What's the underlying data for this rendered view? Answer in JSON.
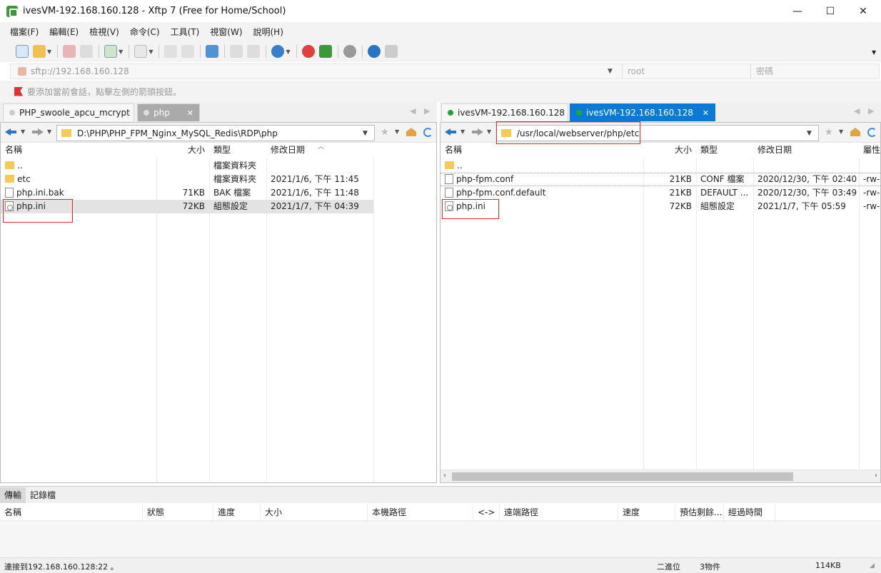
{
  "window": {
    "title": "ivesVM-192.168.160.128 - Xftp 7 (Free for Home/School)",
    "min": "—",
    "max": "☐",
    "close": "✕"
  },
  "menu": [
    "檔案(F)",
    "編輯(E)",
    "檢視(V)",
    "命令(C)",
    "工具(T)",
    "視窗(W)",
    "說明(H)"
  ],
  "address": {
    "host": "sftp://192.168.160.128",
    "user_placeholder": "root",
    "password_placeholder": "密碼"
  },
  "hint": "要添加當前會話，點擊左側的箭頭按鈕。",
  "local": {
    "tabs": [
      {
        "label": "PHP_swoole_apcu_mcrypt"
      },
      {
        "label": "php",
        "close": "✕"
      }
    ],
    "path": "D:\\PHP\\PHP_FPM_Nginx_MySQL_Redis\\RDP\\php",
    "columns": [
      "名稱",
      "大小",
      "類型",
      "修改日期"
    ],
    "files": [
      {
        "name": "..",
        "size": "",
        "type": "檔案資料夾",
        "date": "",
        "icon": "folder"
      },
      {
        "name": "etc",
        "size": "",
        "type": "檔案資料夾",
        "date": "2021/1/6, 下午 11:45",
        "icon": "folder"
      },
      {
        "name": "php.ini.bak",
        "size": "71KB",
        "type": "BAK 檔案",
        "date": "2021/1/6, 下午 11:48",
        "icon": "doc"
      },
      {
        "name": "php.ini",
        "size": "72KB",
        "type": "組態設定",
        "date": "2021/1/7, 下午 04:39",
        "icon": "ini"
      }
    ]
  },
  "remote": {
    "tabs": [
      {
        "label": "ivesVM-192.168.160.128"
      },
      {
        "label": "ivesVM-192.168.160.128",
        "close": "✕"
      }
    ],
    "path": "/usr/local/webserver/php/etc",
    "columns": [
      "名稱",
      "大小",
      "類型",
      "修改日期",
      "屬性"
    ],
    "files": [
      {
        "name": "..",
        "size": "",
        "type": "",
        "date": "",
        "attr": "",
        "icon": "folder"
      },
      {
        "name": "php-fpm.conf",
        "size": "21KB",
        "type": "CONF 檔案",
        "date": "2020/12/30, 下午 02:40",
        "attr": "-rw-",
        "icon": "doc"
      },
      {
        "name": "php-fpm.conf.default",
        "size": "21KB",
        "type": "DEFAULT ...",
        "date": "2020/12/30, 下午 03:49",
        "attr": "-rw-",
        "icon": "doc"
      },
      {
        "name": "php.ini",
        "size": "72KB",
        "type": "組態設定",
        "date": "2021/1/7, 下午 05:59",
        "attr": "-rw-",
        "icon": "ini"
      }
    ]
  },
  "bottom": {
    "tabs": [
      "傳輸",
      "記錄檔"
    ],
    "columns": [
      "名稱",
      "狀態",
      "進度",
      "大小",
      "本機路徑",
      "<->",
      "遠端路徑",
      "速度",
      "預估剩餘...",
      "經過時間"
    ]
  },
  "status": {
    "connection": "連接到192.168.160.128:22 。",
    "mode": "二進位",
    "count": "3物件",
    "size": "114KB"
  },
  "colors": {
    "accent": "#0a7ad4",
    "highlight": "#e22222",
    "session_dot": "#1fa637"
  }
}
